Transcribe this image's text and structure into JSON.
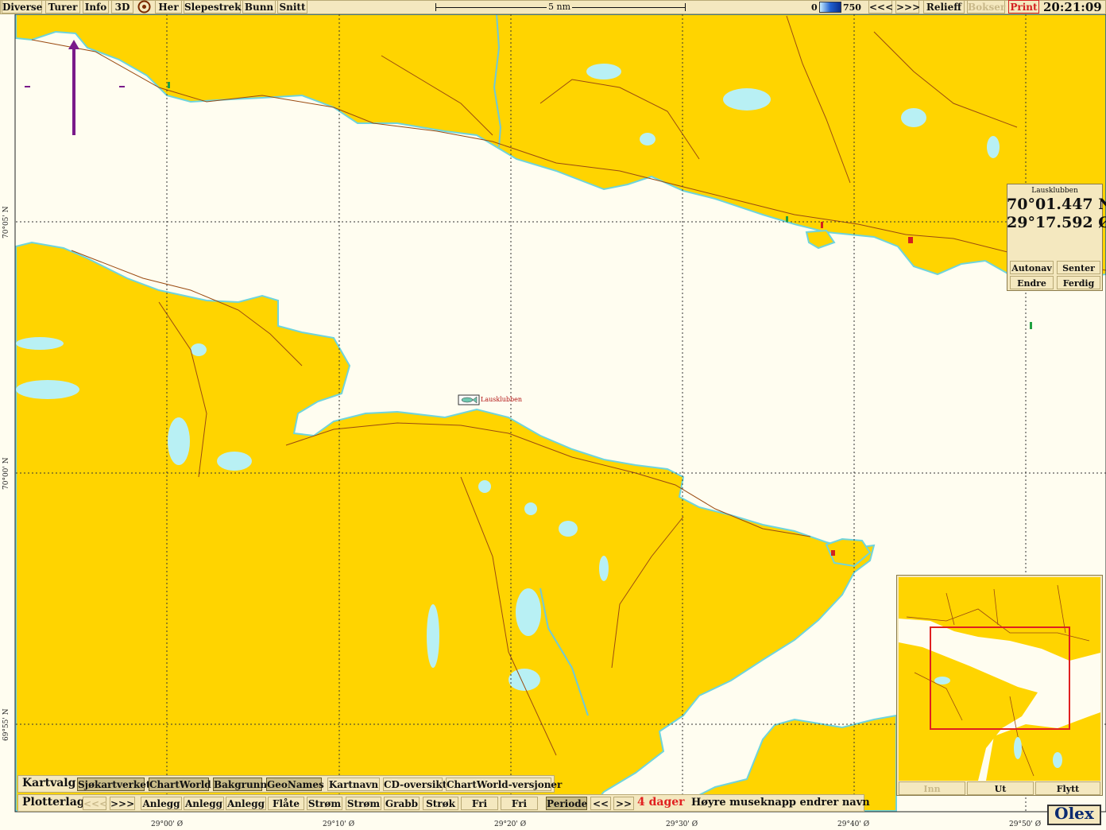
{
  "toolbar": {
    "diverse": "Diverse",
    "turer": "Turer",
    "info": "Info",
    "three_d": "3D",
    "her": "Her",
    "slepestrek": "Slepestrek",
    "bunn": "Bunn",
    "snitt": "Snitt",
    "scale_label": "5 nm",
    "depth_min": "0",
    "depth_max": "750",
    "prev": "<<<",
    "next": ">>>",
    "relieff": "Relieff",
    "bokser": "Bokser",
    "print": "Print",
    "clock": "20:21:09"
  },
  "position_panel": {
    "name": "Lausklubben",
    "lat": "70°01.447 N",
    "lon": "29°17.592 Ø",
    "autonav": "Autonav",
    "senter": "Senter",
    "endre": "Endre",
    "ferdig": "Ferdig"
  },
  "map_marker": {
    "label": "Lausklubben"
  },
  "overview": {
    "inn": "Inn",
    "ut": "Ut",
    "flytt": "Flytt"
  },
  "kartvalg": {
    "title": "Kartvalg",
    "items": [
      "Sjøkartverket",
      "ChartWorld",
      "Bakgrunn",
      "GeoNames",
      "Kartnavn",
      "CD-oversikt",
      "ChartWorld-versjoner"
    ]
  },
  "plotterlag": {
    "title": "Plotterlag",
    "prev": "<<<",
    "next": ">>>",
    "items": [
      "Anlegg",
      "Anlegg",
      "Anlegg",
      "Flåte",
      "Strøm",
      "Strøm",
      "Grabb",
      "Strøk",
      "Fri",
      "Fri"
    ],
    "periode": "Periode",
    "back": "<<",
    "fwd": ">>",
    "days": "4 dager",
    "hint": "Høyre museknapp endrer navn"
  },
  "axes": {
    "lon": [
      "29°00' Ø",
      "29°10' Ø",
      "29°20' Ø",
      "29°30' Ø",
      "29°40' Ø",
      "29°50' Ø"
    ],
    "lat": [
      "70°05' N",
      "70°00' N",
      "69°55' N"
    ]
  },
  "brand": "Olex",
  "colors": {
    "land": "#ffd400",
    "sea": "#fffdf0",
    "lake": "#b8f0f4",
    "road": "#9a4a10",
    "panel": "#f4e8bf",
    "print_red": "#d42020",
    "north_arrow": "#7a1a8a"
  }
}
